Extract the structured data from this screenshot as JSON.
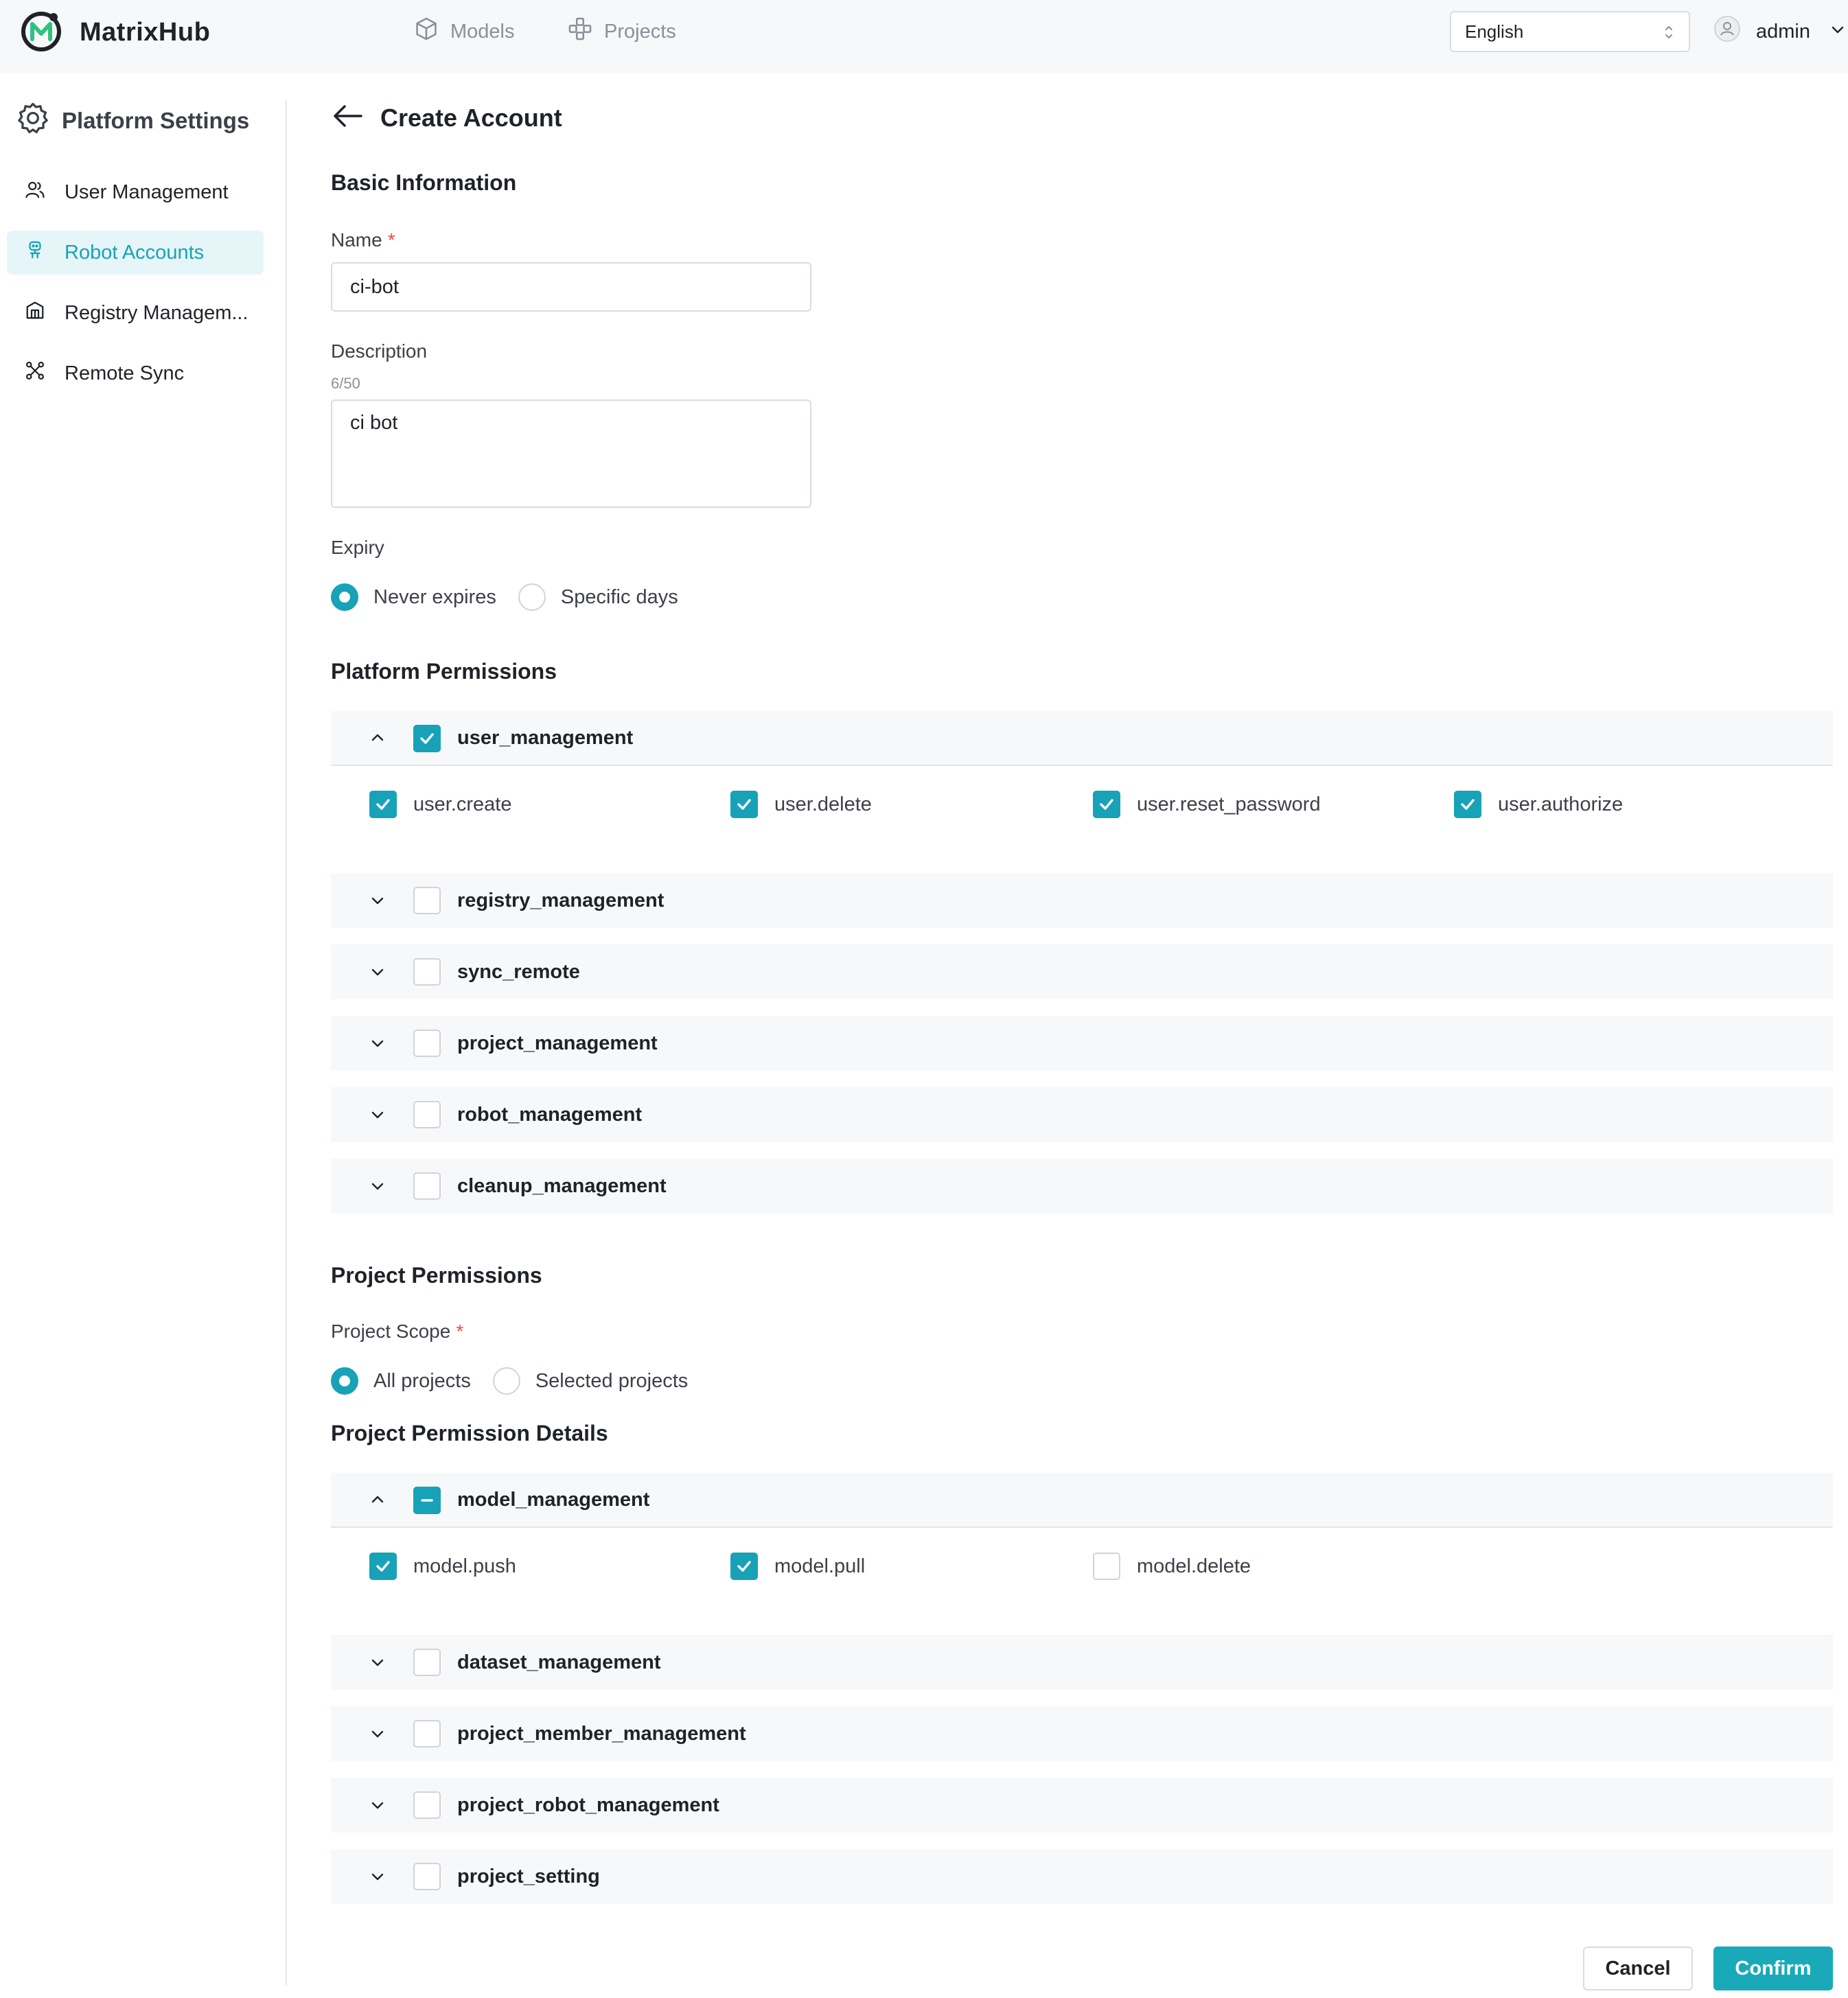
{
  "app": {
    "name": "MatrixHub"
  },
  "topnav": {
    "models_label": "Models",
    "projects_label": "Projects",
    "language_value": "English",
    "user_name": "admin"
  },
  "sidebar": {
    "title": "Platform Settings",
    "items": [
      {
        "label": "User Management",
        "icon": "user-group-icon",
        "active": false
      },
      {
        "label": "Robot Accounts",
        "icon": "robot-icon",
        "active": true
      },
      {
        "label": "Registry Managem...",
        "icon": "building-icon",
        "active": false
      },
      {
        "label": "Remote Sync",
        "icon": "sync-nodes-icon",
        "active": false
      }
    ]
  },
  "page": {
    "title": "Create Account"
  },
  "basic": {
    "title": "Basic Information",
    "name_label": "Name",
    "name_value": "ci-bot",
    "description_label": "Description",
    "description_counter": "6/50",
    "description_value": "ci bot",
    "expiry_label": "Expiry",
    "expiry_options": [
      "Never expires",
      "Specific days"
    ],
    "expiry_selected": "Never expires"
  },
  "platform": {
    "title": "Platform Permissions",
    "groups": [
      {
        "label": "user_management",
        "expanded": true,
        "state": "checked",
        "perms": [
          {
            "label": "user.create",
            "checked": true
          },
          {
            "label": "user.delete",
            "checked": true
          },
          {
            "label": "user.reset_password",
            "checked": true
          },
          {
            "label": "user.authorize",
            "checked": true
          }
        ]
      },
      {
        "label": "registry_management",
        "expanded": false,
        "state": "unchecked"
      },
      {
        "label": "sync_remote",
        "expanded": false,
        "state": "unchecked"
      },
      {
        "label": "project_management",
        "expanded": false,
        "state": "unchecked"
      },
      {
        "label": "robot_management",
        "expanded": false,
        "state": "unchecked"
      },
      {
        "label": "cleanup_management",
        "expanded": false,
        "state": "unchecked"
      }
    ]
  },
  "project": {
    "title": "Project Permissions",
    "scope_label": "Project Scope",
    "scope_options": [
      "All projects",
      "Selected projects"
    ],
    "scope_selected": "All projects",
    "details_title": "Project Permission Details",
    "groups": [
      {
        "label": "model_management",
        "expanded": true,
        "state": "partial",
        "perms": [
          {
            "label": "model.push",
            "checked": true
          },
          {
            "label": "model.pull",
            "checked": true
          },
          {
            "label": "model.delete",
            "checked": false
          }
        ]
      },
      {
        "label": "dataset_management",
        "expanded": false,
        "state": "unchecked"
      },
      {
        "label": "project_member_management",
        "expanded": false,
        "state": "unchecked"
      },
      {
        "label": "project_robot_management",
        "expanded": false,
        "state": "unchecked"
      },
      {
        "label": "project_setting",
        "expanded": false,
        "state": "unchecked"
      }
    ]
  },
  "actions": {
    "cancel_label": "Cancel",
    "confirm_label": "Confirm"
  },
  "colors": {
    "accent": "#17a2b8",
    "required": "#f54a45",
    "active_bg": "#e6f6f8"
  }
}
